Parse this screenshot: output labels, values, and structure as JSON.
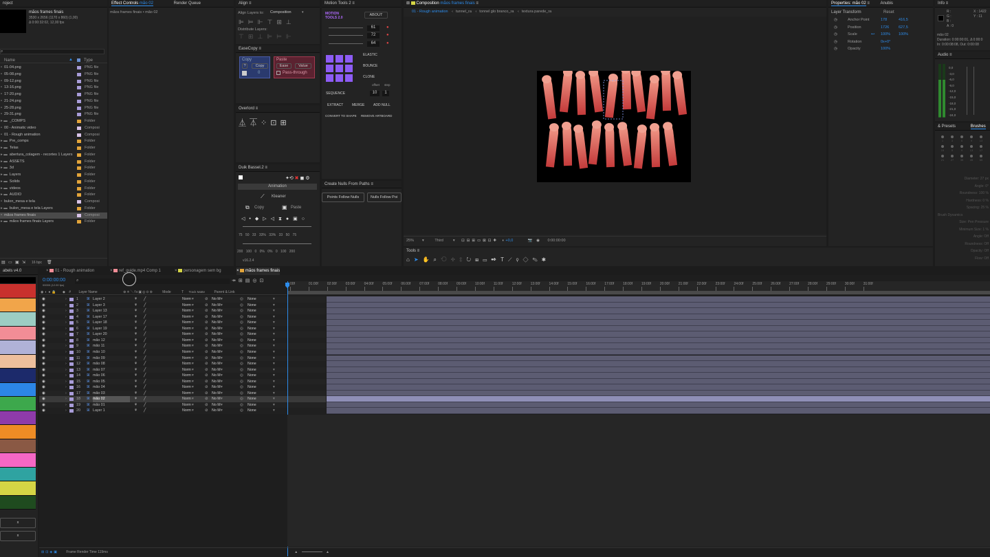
{
  "project": {
    "tab": "roject",
    "name": "mãos frames finais",
    "meta1": "3530 x 2656 (1170 x 860) (1,00)",
    "meta2": "Δ 0:00:32:02, 12,00 fps",
    "col_name": "Name",
    "col_type": "Type",
    "items": [
      {
        "name": "01-04.png",
        "type": "PNG file",
        "color": "#a89cd8",
        "folder": false
      },
      {
        "name": "05-08.png",
        "type": "PNG file",
        "color": "#a89cd8",
        "folder": false
      },
      {
        "name": "09-12.png",
        "type": "PNG file",
        "color": "#a89cd8",
        "folder": false
      },
      {
        "name": "13-16.png",
        "type": "PNG file",
        "color": "#a89cd8",
        "folder": false
      },
      {
        "name": "17-20.png",
        "type": "PNG file",
        "color": "#a89cd8",
        "folder": false
      },
      {
        "name": "21-24.png",
        "type": "PNG file",
        "color": "#a89cd8",
        "folder": false
      },
      {
        "name": "25-28.png",
        "type": "PNG file",
        "color": "#a89cd8",
        "folder": false
      },
      {
        "name": "29-31.png",
        "type": "PNG file",
        "color": "#a89cd8",
        "folder": false
      },
      {
        "name": "_COMPS",
        "type": "Folder",
        "color": "#e2a43a",
        "folder": true
      },
      {
        "name": "00 - Animatic video",
        "type": "Composi",
        "color": "#d8c3e8",
        "folder": false
      },
      {
        "name": "01 - Rough animation",
        "type": "Composi",
        "color": "#d8c3e8",
        "folder": false
      },
      {
        "name": "Pre_comps",
        "type": "Folder",
        "color": "#e2a43a",
        "folder": true
      },
      {
        "name": "Telas",
        "type": "Folder",
        "color": "#e2a43a",
        "folder": true
      },
      {
        "name": "abertura_colagem - recortes 1 Layers",
        "type": "Folder",
        "color": "#e2a43a",
        "folder": true
      },
      {
        "name": "ASSETS",
        "type": "Folder",
        "color": "#e2a43a",
        "folder": true
      },
      {
        "name": "3d",
        "type": "Folder",
        "color": "#e2a43a",
        "folder": true
      },
      {
        "name": "Layers",
        "type": "Folder",
        "color": "#e2a43a",
        "folder": true
      },
      {
        "name": "Solids",
        "type": "Folder",
        "color": "#e2a43a",
        "folder": true
      },
      {
        "name": "videos",
        "type": "Folder",
        "color": "#e2a43a",
        "folder": true
      },
      {
        "name": "AUDIO",
        "type": "Folder",
        "color": "#e2a43a",
        "folder": true
      },
      {
        "name": "bulon_mesa e tela",
        "type": "Composi",
        "color": "#d8c3e8",
        "folder": false
      },
      {
        "name": "bulon_mesa e tela Layers",
        "type": "Folder",
        "color": "#e2a43a",
        "folder": true
      },
      {
        "name": "mãos frames finais",
        "type": "Composi",
        "color": "#d8c3e8",
        "folder": false,
        "selected": true
      },
      {
        "name": "mãos frames finais Layers",
        "type": "Folder",
        "color": "#e2a43a",
        "folder": true
      }
    ],
    "bpc": "16 bpc"
  },
  "effect_controls": {
    "tab": "Effect Controls",
    "target": "mão 02",
    "tab2": "Render Queue",
    "path": "mãos frames finais • mão 02"
  },
  "align": {
    "tab": "Align",
    "layers_to_label": "Align Layers to:",
    "layers_to_value": "Composition",
    "distribute": "Distribute Layers:"
  },
  "easecopy": {
    "tab": "EaseCopy",
    "copy_label": "Copy",
    "copy_btn": "Copy",
    "paste_label": "Paste",
    "ease_btn": "Ease",
    "value_btn": "Value",
    "passthrough": "Pass-through",
    "q": "?",
    "zero": "0"
  },
  "overlord": {
    "tab": "Overlord"
  },
  "duik": {
    "tab": "Duik Bassel.2",
    "animation": "Animation",
    "kleaner": "Kleaner",
    "copy": "Copy",
    "paste": "Paste",
    "r1": [
      "75",
      "50",
      "33",
      "33%",
      "33%",
      "33",
      "50",
      "75"
    ],
    "r2": [
      "200",
      "100",
      "0",
      "0%",
      "0%",
      "0",
      "100",
      "200"
    ],
    "version": "v16.2.4"
  },
  "motion_tools": {
    "tab": "Motion Tools 2",
    "brand": "MOTION TOOLS 2.0",
    "about": "ABOUT",
    "v1": "61",
    "v2": "72",
    "v3": "64",
    "elastic": "ELASTIC",
    "bounce": "BOUNCE",
    "clone": "CLONE",
    "offset": "offset",
    "step": "step",
    "sequence": "SEQUENCE",
    "seq1": "10",
    "seq2": "1",
    "extract": "EXTRACT",
    "merge": "MERGE",
    "addnull": "ADD NULL",
    "convert": "CONVERT TO SHAPE",
    "remove": "REMOVE ARTBOARD"
  },
  "nulls": {
    "tab": "Create Nulls From Paths",
    "b1": "Points Follow Nulls",
    "b2": "Nulls Follow Poi"
  },
  "composition": {
    "tab": "Composition",
    "name": "mãos frames finais",
    "crumbs": [
      "01 - Rough animation",
      "tunnel_ra",
      "tonnel glo branco_ra",
      "textura parede_ra"
    ],
    "zoom": "25%",
    "quality": "Third",
    "exposure": "+0,0",
    "timecode": "0:00:00:00"
  },
  "tools": {
    "tab": "Tools"
  },
  "properties": {
    "tab": "Properties: mão 02",
    "tab2": "Anubis",
    "section": "Layer Transform",
    "reset": "Reset",
    "rows": [
      {
        "name": "Anchor Point",
        "v1": "178",
        "v2": "416,5"
      },
      {
        "name": "Position",
        "v1": "1726",
        "v2": "627,5"
      },
      {
        "name": "Scale",
        "v1": "100%",
        "v2": "100%"
      },
      {
        "name": "Rotation",
        "v1": "0x+0°",
        "v2": ""
      },
      {
        "name": "Opacity",
        "v1": "100%",
        "v2": ""
      }
    ]
  },
  "info": {
    "tab": "Info",
    "r": "R :",
    "g": "G :",
    "b": "B :",
    "a": "A : 0",
    "x": "X : 1422",
    "y": "Y : 11",
    "layer": "mão 02",
    "duration": "Duration: 0:00:00:01, Δ 0:00:0",
    "inout": "In: 0:00:08:08, Out: 0:00:08"
  },
  "audio": {
    "tab": "Audio",
    "scale": [
      "0,0",
      "-3,0",
      "-6,0",
      "-9,0",
      "-12,0",
      "-15,0",
      "-18,0",
      "-21,0",
      "-24,0"
    ]
  },
  "brushes": {
    "tab1": "& Presets",
    "tab2": "Brushes",
    "nums": [
      "1",
      "3",
      "5",
      "9",
      "13",
      "19",
      "5",
      "9",
      "13",
      "17",
      "21",
      "27",
      "35",
      "45",
      "65"
    ],
    "diameter": "Diameter: 27 px",
    "angle": "Angle: 0°",
    "roundness": "Roundness: 100 %",
    "hardness": "Hardness: 0 %",
    "spacing": "Spacing: 25 %",
    "dyn": "Brush Dynamics",
    "size": "Size: Pen Pressure",
    "mindiam": "Minimum Size: 1 %",
    "angle2": "Angle: Off",
    "round2": "Roundness: Off",
    "opacity": "Opacity: Off",
    "flow": "Flow: Off"
  },
  "labels": {
    "tab": "abels v4.0",
    "colors": [
      "#c8312d",
      "#f1a54a",
      "#9ccdc3",
      "#f28d96",
      "#b0b2d7",
      "#edbf9c",
      "#1c2a6b",
      "#2c86e7",
      "#3da84c",
      "#8e3baa",
      "#ee8c25",
      "#8a5944",
      "#f567c5",
      "#2fa3a1",
      "#d5d545",
      "#1f4b1f"
    ],
    "x": "x"
  },
  "timeline": {
    "tabs": [
      {
        "label": "01 - Rough animation",
        "color": "#f28d96"
      },
      {
        "label": "ref_guide.mp4 Comp 1",
        "color": "#f28d96"
      },
      {
        "label": "personagem sem bg",
        "color": "#d5d545"
      },
      {
        "label": "mãos frames finais",
        "color": "#e2a43a"
      }
    ],
    "time": "0:00:00:00",
    "fps": "00000 (12.00 fps)",
    "h_layer": "Layer Name",
    "h_mode": "Mode",
    "h_t": "T",
    "h_track": "Track Matte",
    "h_parent": "Parent & Link",
    "ticks": [
      "00f",
      "01:00f",
      "02:00f",
      "03:00f",
      "04:00f",
      "05:00f",
      "06:00f",
      "07:00f",
      "08:00f",
      "09:00f",
      "10:00f",
      "11:00f",
      "12:00f",
      "13:00f",
      "14:00f",
      "15:00f",
      "16:00f",
      "17:00f",
      "18:00f",
      "19:00f",
      "20:00f",
      "21:00f",
      "22:00f",
      "23:00f",
      "24:00f",
      "25:00f",
      "26:00f",
      "27:00f",
      "28:00f",
      "29:00f",
      "30:00f",
      "31:00f"
    ],
    "layers": [
      {
        "n": "1",
        "name": "Layer 2"
      },
      {
        "n": "2",
        "name": "Layer 3"
      },
      {
        "n": "3",
        "name": "Layer 13"
      },
      {
        "n": "4",
        "name": "Layer 17"
      },
      {
        "n": "5",
        "name": "Layer 18"
      },
      {
        "n": "6",
        "name": "Layer 19"
      },
      {
        "n": "7",
        "name": "Layer 20"
      },
      {
        "n": "8",
        "name": "mão 12"
      },
      {
        "n": "9",
        "name": "mão 11"
      },
      {
        "n": "10",
        "name": "mão 10"
      },
      {
        "n": "11",
        "name": "mão 09"
      },
      {
        "n": "12",
        "name": "mão 08"
      },
      {
        "n": "13",
        "name": "mão 07"
      },
      {
        "n": "14",
        "name": "mão 06"
      },
      {
        "n": "15",
        "name": "mão 05"
      },
      {
        "n": "16",
        "name": "mão 04"
      },
      {
        "n": "17",
        "name": "mão 03"
      },
      {
        "n": "18",
        "name": "mão 02",
        "selected": true
      },
      {
        "n": "19",
        "name": "mão 01"
      },
      {
        "n": "20",
        "name": "Layer 1"
      }
    ],
    "mode": "Norm",
    "track": "No M",
    "parent": "None",
    "render_time": "Frame Render Time  119ms"
  }
}
